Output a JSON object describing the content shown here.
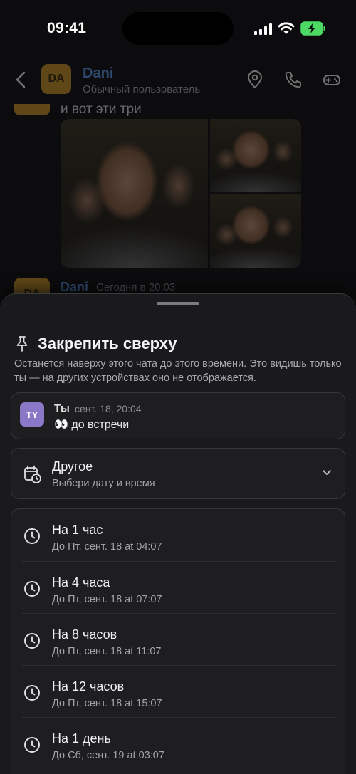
{
  "status_bar": {
    "time": "09:41"
  },
  "chat_header": {
    "avatar_initials": "DA",
    "name": "Dani",
    "status": "Обычный пользователь"
  },
  "messages": {
    "text": "и вот эти три",
    "second_author_initials": "DA",
    "second_author": "Dani",
    "second_time": "Сегодня в 20:03"
  },
  "sheet": {
    "title": "Закрепить сверху",
    "description": "Останется наверху этого чата до этого времени. Это видишь только ты — на других устройствах оно не отображается.",
    "pinned_message": {
      "avatar_initials": "TY",
      "author": "Ты",
      "date": "сент. 18, 20:04",
      "text": "👀 до встречи"
    },
    "other": {
      "title": "Другое",
      "subtitle": "Выбери дату и время"
    },
    "options": [
      {
        "title": "На 1 час",
        "subtitle": "До Пт, сент. 18 at 04:07"
      },
      {
        "title": "На 4 часа",
        "subtitle": "До Пт, сент. 18 at 07:07"
      },
      {
        "title": "На 8 часов",
        "subtitle": "До Пт, сент. 18 at 11:07"
      },
      {
        "title": "На 12 часов",
        "subtitle": "До Пт, сент. 18 at 15:07"
      },
      {
        "title": "На 1 день",
        "subtitle": "До Сб, сент. 19 at 03:07"
      }
    ]
  },
  "colors": {
    "accent_name": "#5d9bf0",
    "avatar_peer": "#d29a28",
    "avatar_self": "#8a78c6",
    "battery_charging": "#4cd964"
  }
}
